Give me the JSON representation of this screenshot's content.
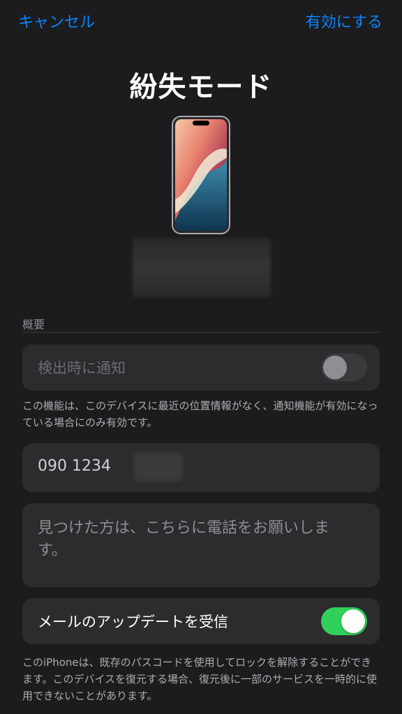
{
  "nav": {
    "cancel_label": "キャンセル",
    "enable_label": "有効にする"
  },
  "title": "紛失モード",
  "section": {
    "label": "概要"
  },
  "notify": {
    "label": "検出時に通知",
    "toggle_on": false
  },
  "notify_note": "この機能は、このデバイスに最近の位置情報がなく、通知機能が有効になっている場合にのみ有効です。",
  "phone": {
    "value": "090 1234"
  },
  "message": {
    "text": "見つけた方は、こちらに電話をお願いします。"
  },
  "email_updates": {
    "label": "メールのアップデートを受信",
    "toggle_on": true
  },
  "bottom_note": "このiPhoneは、既存のパスコードを使用してロックを解除することができます。このデバイスを復元する場合、復元後に一部のサービスを一時的に使用できないことがあります。",
  "colors": {
    "accent": "#0a84ff",
    "toggle_on": "#30d158",
    "background": "#1c1c1e",
    "card": "#2c2c2e"
  }
}
